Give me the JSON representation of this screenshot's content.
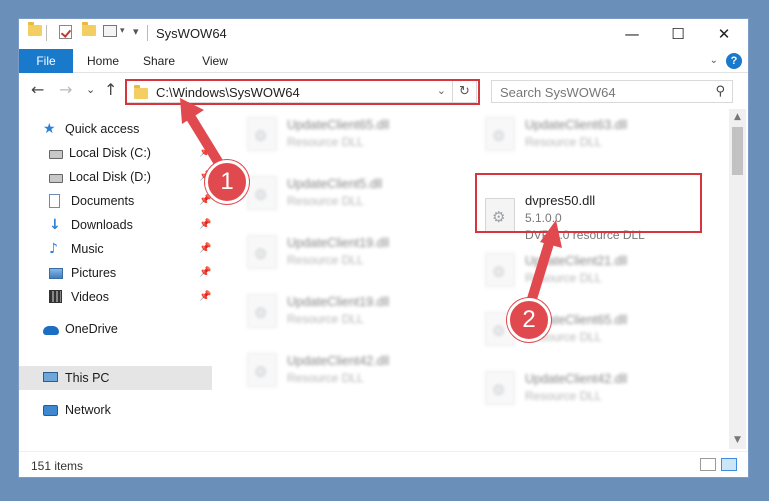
{
  "window": {
    "title": "SysWOW64",
    "min_glyph": "—",
    "max_glyph": "☐",
    "close_glyph": "✕"
  },
  "ribbon": {
    "tabs": [
      "File",
      "Home",
      "Share",
      "View"
    ],
    "collapse_glyph": "⌄",
    "help_glyph": "?"
  },
  "address_bar": {
    "back_glyph": "←",
    "forward_glyph": "→",
    "recent_glyph": "⌄",
    "up_glyph": "↑",
    "path": "C:\\Windows\\SysWOW64",
    "dropdown_glyph": "⌄",
    "refresh_glyph": "↻"
  },
  "search": {
    "placeholder": "Search SysWOW64",
    "icon_glyph": "⚲"
  },
  "sidebar": {
    "items": [
      {
        "label": "Quick access",
        "icon": "star-icon",
        "pinned": false
      },
      {
        "label": "Local Disk (C:)",
        "icon": "drive-icon",
        "pinned": true
      },
      {
        "label": "Local Disk (D:)",
        "icon": "drive-icon",
        "pinned": true
      },
      {
        "label": "Documents",
        "icon": "documents-icon",
        "pinned": true
      },
      {
        "label": "Downloads",
        "icon": "downloads-icon",
        "pinned": true
      },
      {
        "label": "Music",
        "icon": "music-icon",
        "pinned": true
      },
      {
        "label": "Pictures",
        "icon": "pictures-icon",
        "pinned": true
      },
      {
        "label": "Videos",
        "icon": "videos-icon",
        "pinned": true
      },
      {
        "label": "OneDrive",
        "icon": "onedrive-icon",
        "pinned": false
      },
      {
        "label": "This PC",
        "icon": "this-pc-icon",
        "pinned": false,
        "selected": true
      },
      {
        "label": "Network",
        "icon": "network-icon",
        "pinned": false
      }
    ],
    "pin_glyph": "📌"
  },
  "files": {
    "left_column": [
      {
        "name": "UpdateClient65.dll",
        "type": "Resource DLL"
      },
      {
        "name": "UpdateClient5.dll",
        "type": "Resource DLL"
      },
      {
        "name": "UpdateClient19.dll",
        "type": "Resource DLL"
      },
      {
        "name": "UpdateClient19.dll",
        "type": "Resource DLL"
      },
      {
        "name": "UpdateClient42.dll",
        "type": "Resource DLL"
      }
    ],
    "right_column": [
      {
        "name": "UpdateClient63.dll",
        "type": "Resource DLL"
      },
      {
        "name": "dvpres50.dll",
        "version": "5.1.0.0",
        "type": "DVP 5.0 resource DLL",
        "highlighted": true
      },
      {
        "name": "UpdateClient21.dll",
        "type": "Resource DLL"
      },
      {
        "name": "UpdateClient65.dll",
        "type": "Resource DLL"
      },
      {
        "name": "UpdateClient42.dll",
        "type": "Resource DLL"
      }
    ],
    "gear_glyph": "⚙"
  },
  "status": {
    "item_count": "151 items"
  },
  "annotations": {
    "step1": "1",
    "step2": "2",
    "color": "#e04a4f"
  }
}
